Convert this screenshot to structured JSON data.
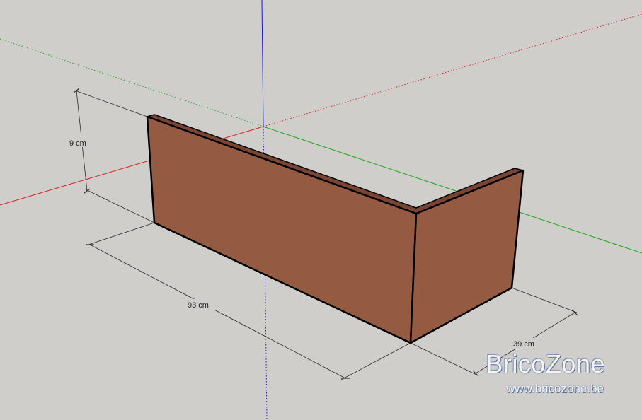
{
  "dimensions": {
    "height": "9 cm",
    "length": "93 cm",
    "width": "39 cm"
  },
  "colors": {
    "background": "#cfcecb",
    "brick_front": "#955a42",
    "brick_side": "#955a42",
    "brick_top": "#7a4432",
    "axis_red": "#d42020",
    "axis_green": "#1aa81a",
    "axis_blue": "#1a1ad0"
  },
  "watermark": {
    "name": "BricoZone",
    "url": "www.bricozone.be"
  }
}
